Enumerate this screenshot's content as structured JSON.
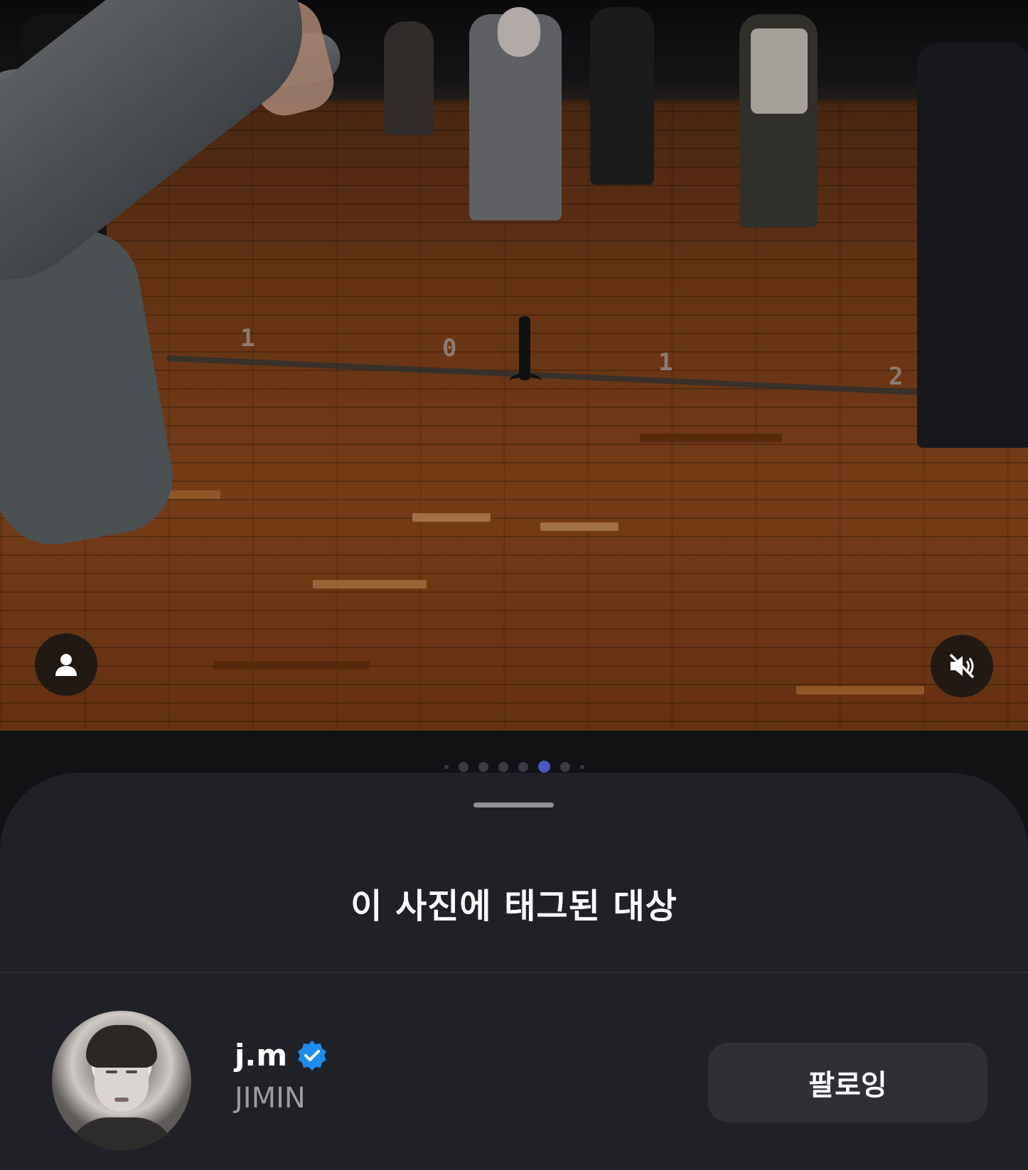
{
  "photo": {
    "floor_numbers": [
      "1",
      "0",
      "1",
      "2"
    ]
  },
  "controls": {
    "tag_icon": "person-icon",
    "mute_icon": "speaker-muted-icon"
  },
  "pager": {
    "total": 8,
    "active_index": 5,
    "active_color": "#4a55c8",
    "inactive_color": "#3a3c42"
  },
  "sheet": {
    "title": "이 사진에 태그된 대상",
    "tagged_users": [
      {
        "username": "j.m",
        "full_name": "JIMIN",
        "verified": true,
        "badge_color": "#1d8cf0",
        "follow_label": "팔로잉"
      }
    ]
  }
}
